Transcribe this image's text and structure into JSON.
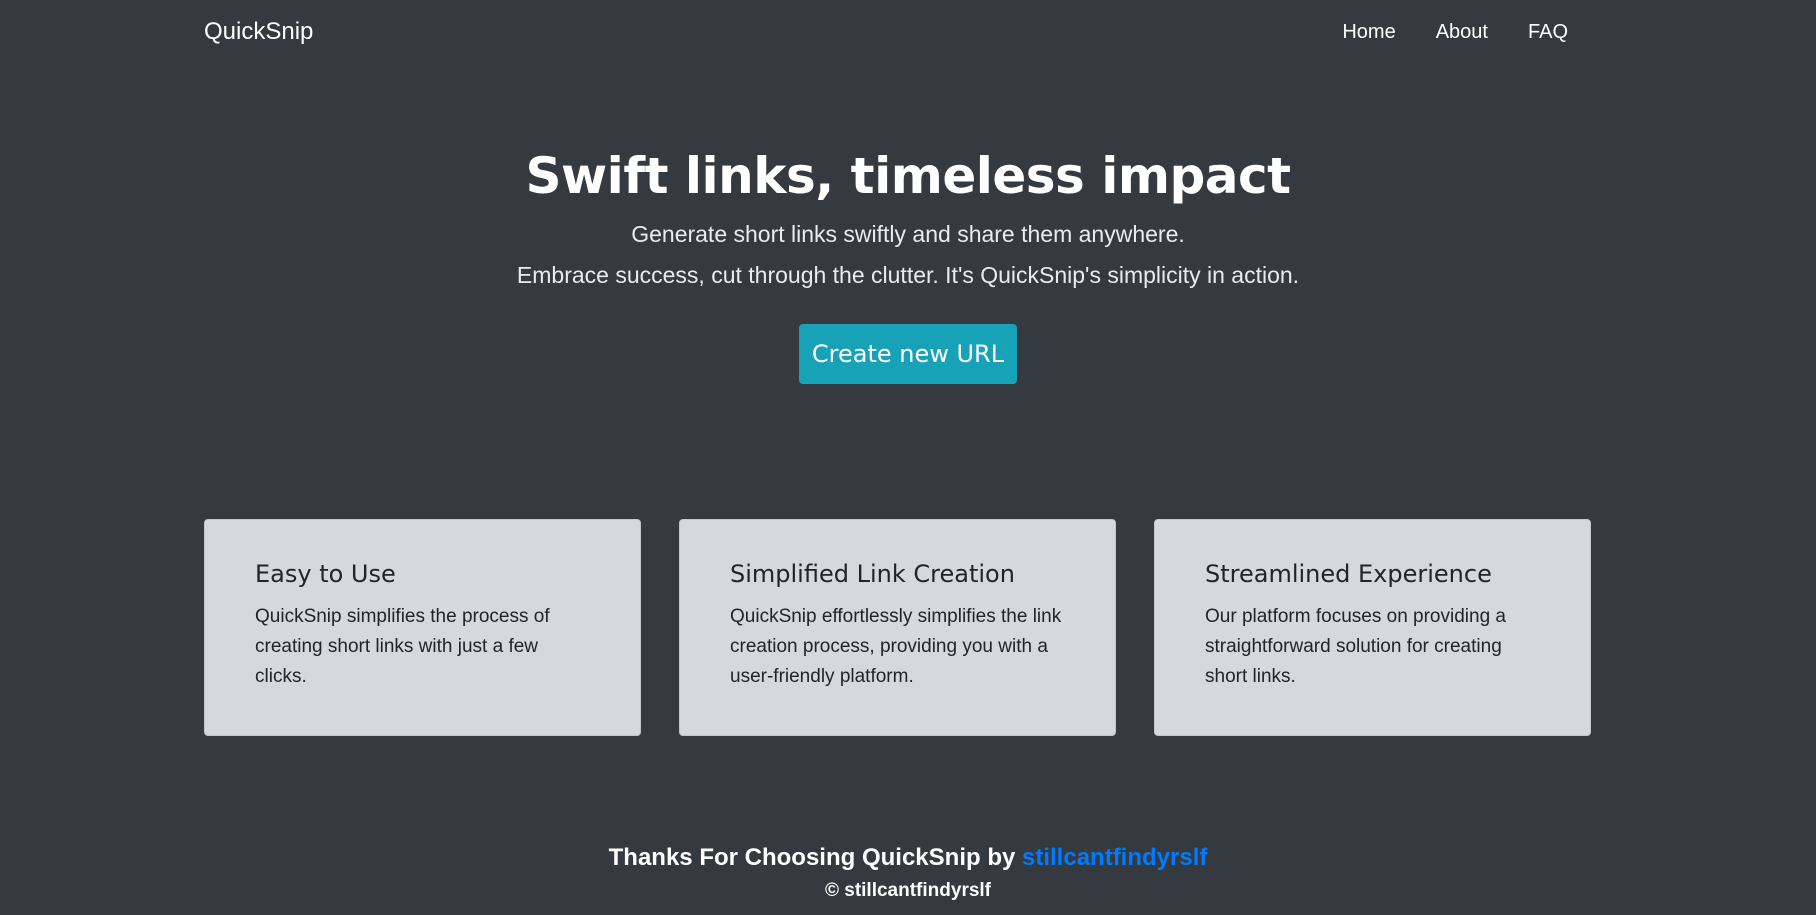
{
  "navbar": {
    "brand": "QuickSnip",
    "links": [
      "Home",
      "About",
      "FAQ"
    ]
  },
  "hero": {
    "title": "Swift links, timeless impact",
    "subtitle_line1": "Generate short links swiftly and share them anywhere.",
    "subtitle_line2": "Embrace success, cut through the clutter. It's QuickSnip's simplicity in action.",
    "cta_label": "Create new URL"
  },
  "cards": [
    {
      "title": "Easy to Use",
      "text": "QuickSnip simplifies the process of creating short links with just a few clicks."
    },
    {
      "title": "Simplified Link Creation",
      "text": "QuickSnip effortlessly simplifies the link creation process, providing you with a user-friendly platform."
    },
    {
      "title": "Streamlined Experience",
      "text": "Our platform focuses on providing a straightforward solution for creating short links."
    }
  ],
  "footer": {
    "thanks_text": "Thanks For Choosing QuickSnip by ",
    "author_link": "stillcantfindyrslf",
    "copyright": "© stillcantfindyrslf"
  },
  "colors": {
    "background": "#343a40",
    "accent": "#17a2b8",
    "link": "#007bff",
    "card_bg": "#d6d8db"
  }
}
